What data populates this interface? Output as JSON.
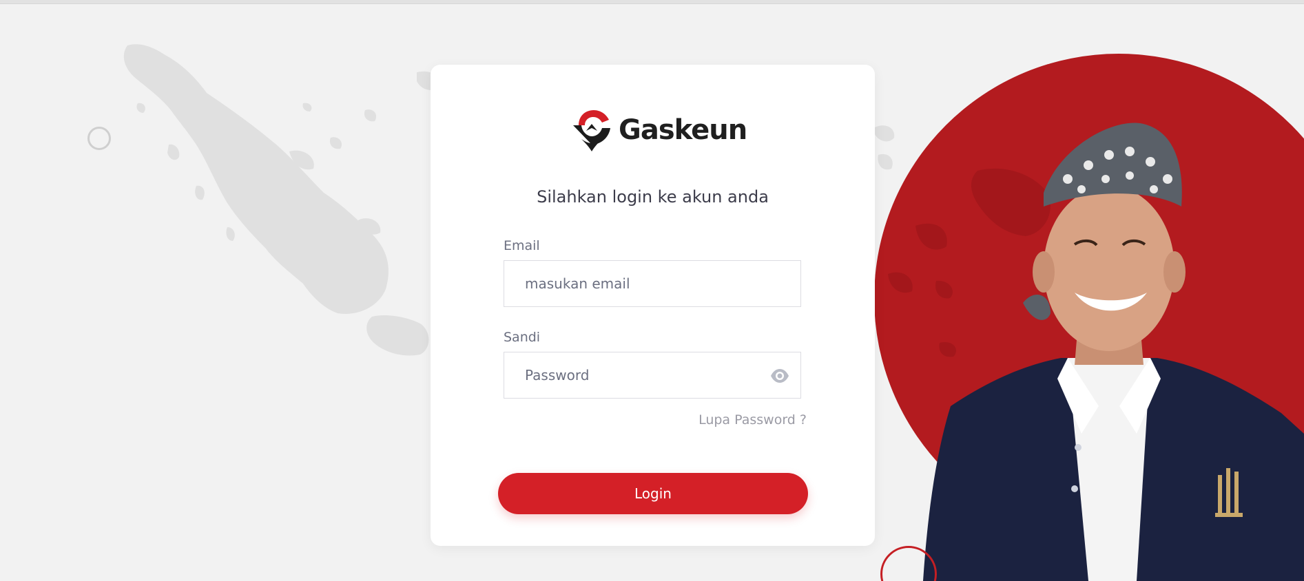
{
  "brand": {
    "name": "Gaskeun",
    "logo_icon": "gaskeun-pin-logo-icon",
    "primary_color": "#d42027",
    "circle_color": "#b31b1f"
  },
  "login_form": {
    "title": "Silahkan login ke akun anda",
    "email": {
      "label": "Email",
      "placeholder": "masukan email",
      "value": ""
    },
    "password": {
      "label": "Sandi",
      "placeholder": "Password",
      "value": "",
      "toggle_icon": "eye-icon"
    },
    "forgot_label": "Lupa Password ?",
    "submit_label": "Login"
  },
  "background": {
    "map_color": "#e0e0e0",
    "page_color": "#f2f2f2"
  }
}
